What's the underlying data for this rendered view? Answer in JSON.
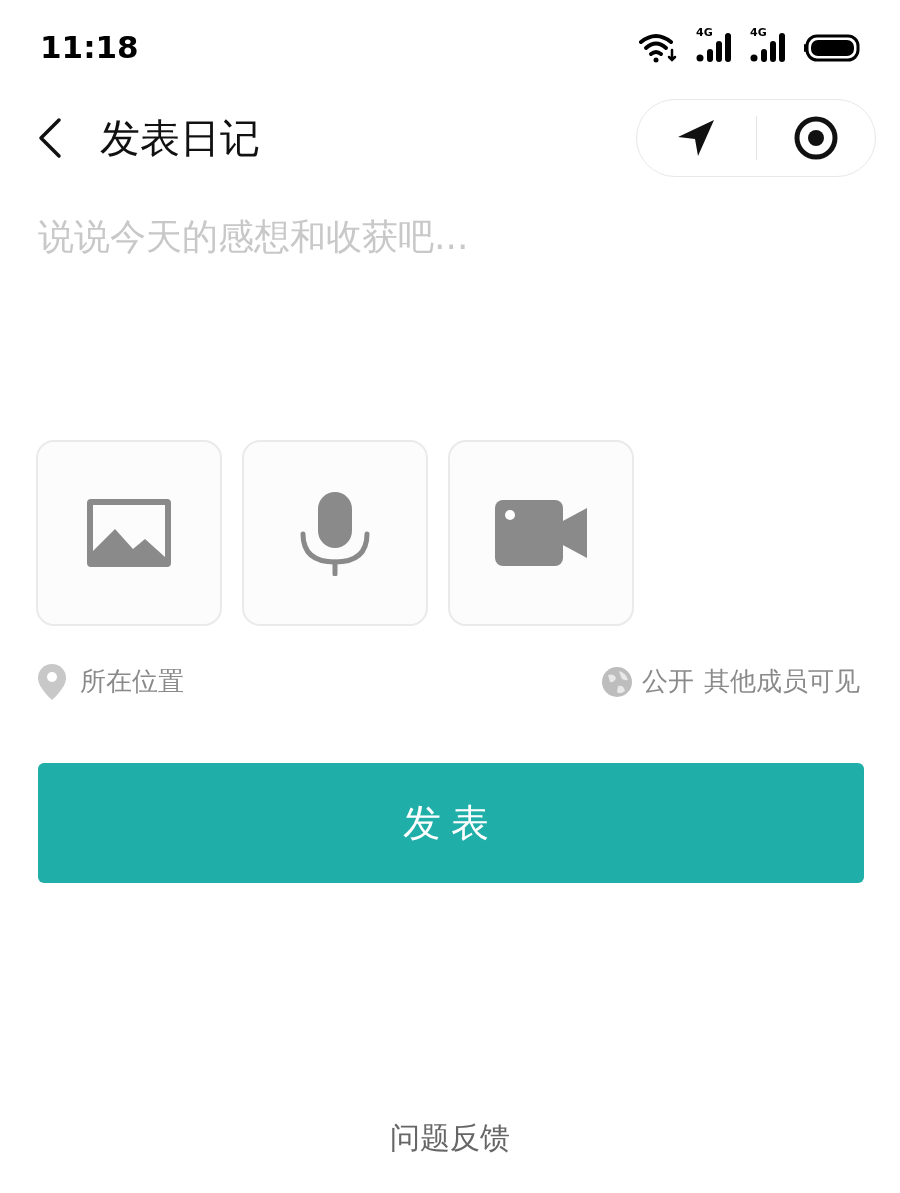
{
  "status_bar": {
    "time": "11:18",
    "networks": [
      {
        "label": "4G"
      },
      {
        "label": "4G"
      }
    ]
  },
  "header": {
    "title": "发表日记"
  },
  "compose": {
    "placeholder": "说说今天的感想和收获吧..."
  },
  "attachments": [
    {
      "kind": "image"
    },
    {
      "kind": "audio"
    },
    {
      "kind": "video"
    }
  ],
  "location": {
    "label": "所在位置"
  },
  "visibility": {
    "label": "公开",
    "description": "其他成员可见"
  },
  "submit": {
    "label": "发表"
  },
  "footer_link": "问题反馈"
}
